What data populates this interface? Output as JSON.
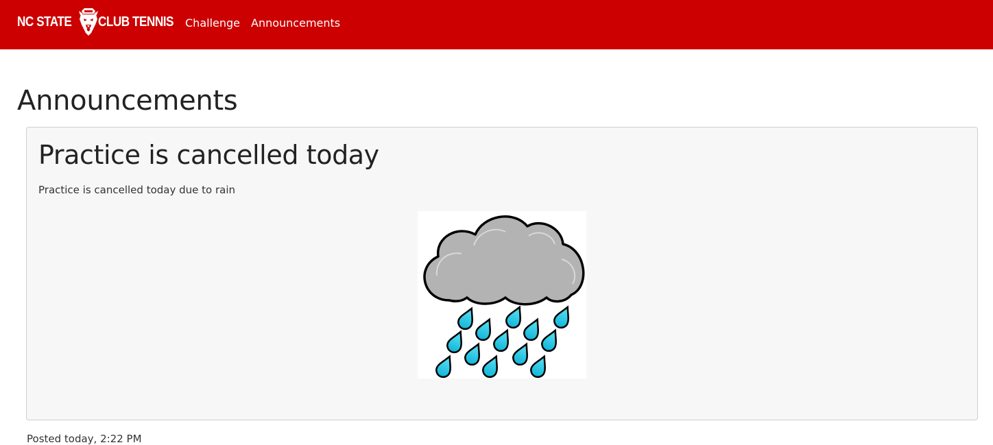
{
  "navbar": {
    "brand_left": "NC STATE",
    "brand_right": "CLUB TENNIS",
    "background_color": "#cc0000",
    "links": [
      {
        "label": "Challenge"
      },
      {
        "label": "Announcements"
      }
    ]
  },
  "page": {
    "title": "Announcements"
  },
  "announcements": [
    {
      "title": "Practice is cancelled today",
      "body": "Practice is cancelled today due to rain",
      "image_icon": "rain-cloud-icon",
      "posted": "Posted today, 2:22 PM"
    }
  ]
}
